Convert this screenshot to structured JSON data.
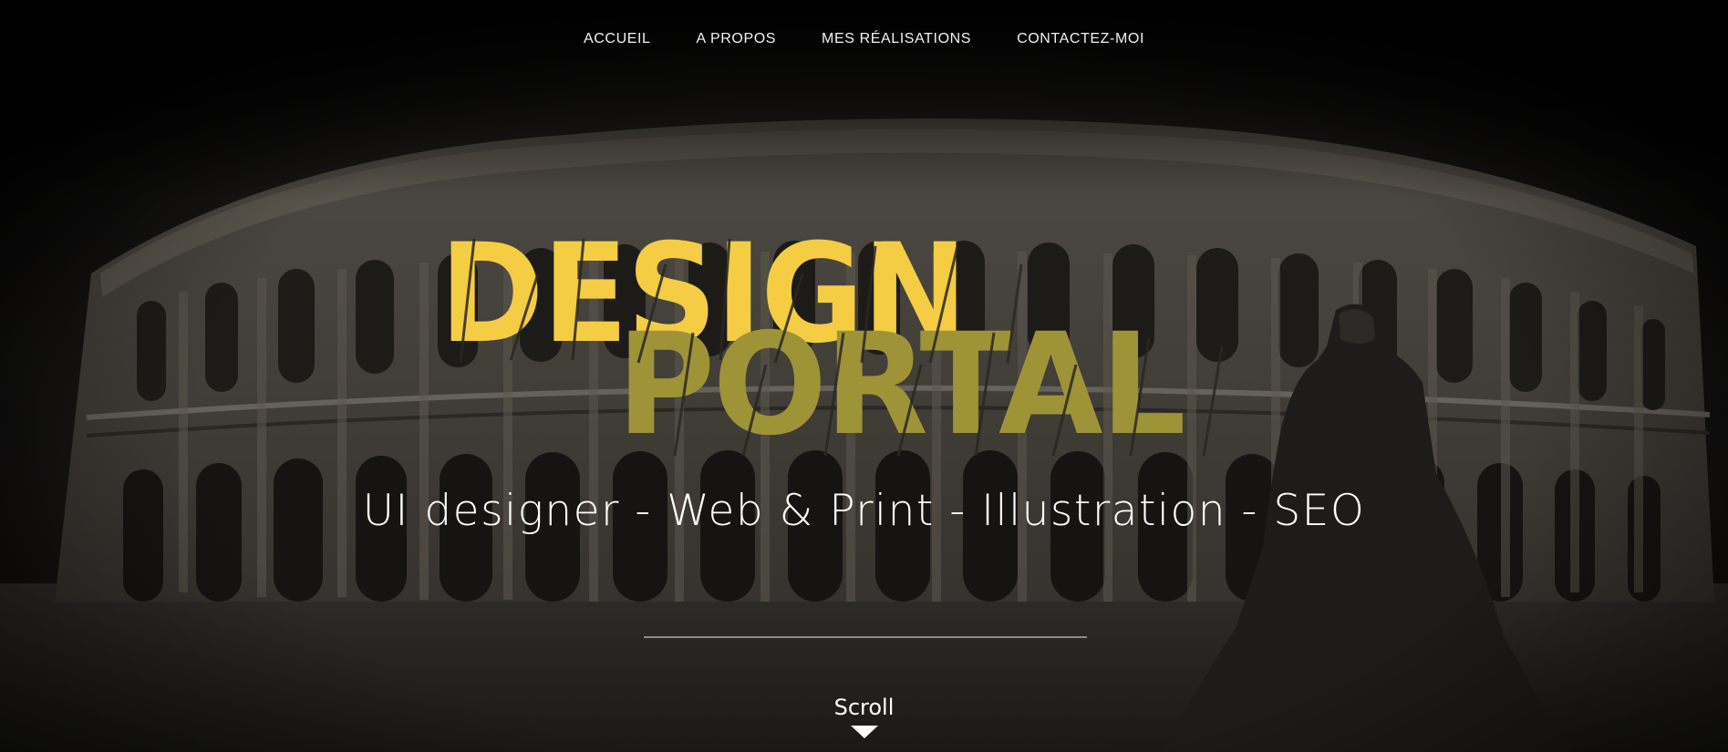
{
  "nav": {
    "items": [
      {
        "label": "ACCUEIL"
      },
      {
        "label": "A PROPOS"
      },
      {
        "label": "MES RÉALISATIONS"
      },
      {
        "label": "CONTACTEZ-MOI"
      }
    ]
  },
  "logo": {
    "line1": "DESIGN",
    "line2": "PORTAL"
  },
  "hero": {
    "tagline": "UI designer - Web & Print - Illustration - SEO",
    "scroll_label": "Scroll"
  },
  "colors": {
    "logo_primary": "#f4cd45",
    "logo_secondary": "#9e9337",
    "background": "#000000",
    "text": "#ffffff"
  },
  "icons": {
    "scroll": "triangle-down-icon"
  }
}
